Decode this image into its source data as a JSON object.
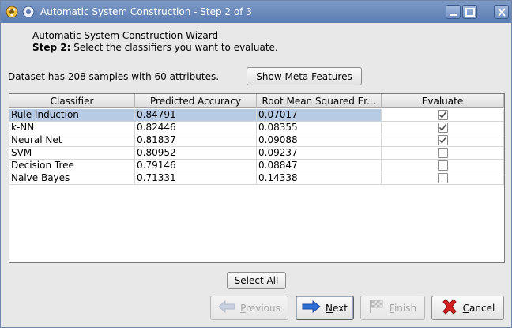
{
  "window": {
    "title": "Automatic System Construction - Step 2 of 3"
  },
  "header": {
    "wizard_name": "Automatic System Construction Wizard",
    "step_label": "Step 2:",
    "step_text": "Select the classifiers you want to evaluate."
  },
  "dataset_info": "Dataset has 208 samples with 60 attributes.",
  "buttons": {
    "show_meta": "Show Meta Features",
    "select_all": "Select All",
    "previous": "Previous",
    "next": "Next",
    "finish": "Finish",
    "cancel": "Cancel"
  },
  "table": {
    "columns": [
      "Classifier",
      "Predicted Accuracy",
      "Root Mean Squared Er...",
      "Evaluate"
    ],
    "rows": [
      {
        "classifier": "Rule Induction",
        "accuracy": "0.84791",
        "rmse": "0.07017",
        "evaluate": true,
        "selected": true
      },
      {
        "classifier": "k-NN",
        "accuracy": "0.82446",
        "rmse": "0.08355",
        "evaluate": true,
        "selected": false
      },
      {
        "classifier": "Neural Net",
        "accuracy": "0.81837",
        "rmse": "0.09088",
        "evaluate": true,
        "selected": false
      },
      {
        "classifier": "SVM",
        "accuracy": "0.80952",
        "rmse": "0.09237",
        "evaluate": false,
        "selected": false
      },
      {
        "classifier": "Decision Tree",
        "accuracy": "0.79146",
        "rmse": "0.08847",
        "evaluate": false,
        "selected": false
      },
      {
        "classifier": "Naive Bayes",
        "accuracy": "0.71331",
        "rmse": "0.14338",
        "evaluate": false,
        "selected": false
      }
    ]
  },
  "icons": {
    "app": "gear-icon",
    "menu": "window-menu-icon",
    "previous": "arrow-left-icon",
    "next": "arrow-right-icon",
    "finish": "checkered-flag-icon",
    "cancel": "red-x-icon"
  },
  "colors": {
    "titlebar": "#5b7cb2",
    "selection": "#b8cbe4",
    "next_arrow": "#2f6fd6",
    "cancel_x": "#d42020"
  }
}
